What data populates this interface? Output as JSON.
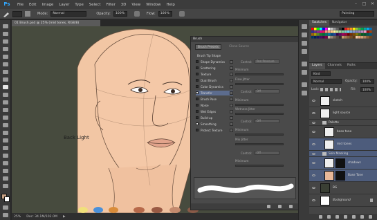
{
  "app": {
    "logo": "Ps",
    "menu": [
      "File",
      "Edit",
      "Image",
      "Layer",
      "Type",
      "Select",
      "Filter",
      "3D",
      "View",
      "Window",
      "Help"
    ],
    "workspace": "Painting"
  },
  "options": {
    "mode_label": "Mode:",
    "mode_value": "Normal",
    "opacity_label": "Opacity:",
    "opacity_value": "100%",
    "flow_label": "Flow:",
    "flow_value": "100%"
  },
  "document": {
    "tab_title": "01 Brush.psd @ 25% (mid tones, RGB/8)",
    "canvas_text": "Back Light",
    "zoom": "25%",
    "doc_info": "Doc: 34.1M/102.0M"
  },
  "brush_panel": {
    "title": "Brush",
    "tab_presets": "Brush Presets",
    "tab_clone": "Clone Source",
    "section_header": "Brush Tip Shape",
    "items": [
      {
        "label": "Shape Dynamics",
        "checked": false
      },
      {
        "label": "Scattering",
        "checked": false
      },
      {
        "label": "Texture",
        "checked": false
      },
      {
        "label": "Dual Brush",
        "checked": false
      },
      {
        "label": "Color Dynamics",
        "checked": false
      },
      {
        "label": "Transfer",
        "checked": true
      },
      {
        "label": "Brush Pose",
        "checked": false
      },
      {
        "label": "Noise",
        "checked": false
      },
      {
        "label": "Wet Edges",
        "checked": false
      },
      {
        "label": "Build-up",
        "checked": false
      },
      {
        "label": "Smoothing",
        "checked": true
      },
      {
        "label": "Protect Texture",
        "checked": false
      }
    ],
    "control_label": "Control:",
    "control_value_1": "Pen Pressure",
    "control_value_off": "Off",
    "minimum_label": "Minimum",
    "flow_jitter_label": "Flow Jitter",
    "wetness_jitter_label": "Wetness Jitter",
    "mix_jitter_label": "Mix Jitter"
  },
  "swatches_panel": {
    "tabs": [
      "Swatches",
      "Navigator"
    ],
    "colors": [
      "#ff0000",
      "#ffff00",
      "#00ff00",
      "#00ffff",
      "#0000ff",
      "#ff00ff",
      "#ffffff",
      "#c8c8c8",
      "#969696",
      "#646464",
      "#323232",
      "#000000",
      "#ed1c24",
      "#f26522",
      "#f7941d",
      "#fff200",
      "#8dc63f",
      "#39b54a",
      "#00a651",
      "#00a99d",
      "#00aeef",
      "#0072bc",
      "#2e3192",
      "#662d91",
      "#92278f",
      "#ec008c",
      "#ed145b",
      "#f69679",
      "#f9ad81",
      "#fdc68a",
      "#fff799",
      "#c4df9b",
      "#a3d39c",
      "#82ca9c",
      "#7accc8",
      "#6dcff6",
      "#7da7d9",
      "#8393ca",
      "#8781bd",
      "#a186be",
      "#bd8cbf",
      "#f49ac1",
      "#9e0b0f",
      "#a0410d",
      "#a36209",
      "#aba000",
      "#598527",
      "#1a7b30",
      "#007236",
      "#00746b",
      "#0076a3",
      "#004b80",
      "#21409a",
      "#32004b",
      "#630460",
      "#9e005d",
      "#9e0039",
      "#790000",
      "#7b2e00",
      "#7d4900",
      "#827b00",
      "#406618",
      "#005e20",
      "#005826",
      "#005952",
      "#005b7f",
      "#003663",
      "#002157",
      "#1b1464",
      "#440e62",
      "#4b0049",
      "#7b0046",
      "#c7b299",
      "#998675",
      "#736357",
      "#534741",
      "#37302a",
      "#c69c6d",
      "#a67c52",
      "#8c6239",
      "#754c24",
      "#603913",
      "#f5cba7",
      "#e8a87c",
      "#d4a373",
      "#b5835a",
      "#8b5e34",
      "#6f4518"
    ]
  },
  "layers_panel": {
    "tabs": [
      "Layers",
      "Channels",
      "Paths"
    ],
    "kind_label": "Kind",
    "blend_mode": "Normal",
    "opacity_label": "Opacity:",
    "opacity_value": "100%",
    "lock_label": "Lock:",
    "fill_label": "Fill:",
    "fill_value": "100%",
    "layers": [
      {
        "name": "sketch",
        "type": "layer",
        "indent": 0,
        "selected": false,
        "thumb": "#f0f0f0"
      },
      {
        "name": "light source",
        "type": "layer",
        "indent": 0,
        "selected": false,
        "thumb": "#f0f0f0"
      },
      {
        "name": "Palette",
        "type": "group",
        "indent": 0,
        "selected": false
      },
      {
        "name": "base tone",
        "type": "layer",
        "indent": 1,
        "selected": false,
        "thumb": "#f0f0f0"
      },
      {
        "name": "mid tones",
        "type": "layer",
        "indent": 1,
        "selected": true,
        "thumb": "#f0f0f0"
      },
      {
        "name": "Skin Masking",
        "type": "group",
        "indent": 0,
        "selected": true
      },
      {
        "name": "shadows",
        "type": "layer",
        "indent": 1,
        "selected": true,
        "thumb": "#f0f0f0",
        "mask": true
      },
      {
        "name": "Base Tone",
        "type": "layer",
        "indent": 1,
        "selected": true,
        "thumb": "#e8b899",
        "mask": true
      },
      {
        "name": "BG",
        "type": "layer",
        "indent": 0,
        "selected": false,
        "thumb": "#3a3f34"
      },
      {
        "name": "Background",
        "type": "layer",
        "indent": 0,
        "selected": false,
        "thumb": "#ffffff"
      }
    ]
  },
  "palette_blobs": [
    "#f0e07a",
    "#4a90d9",
    "#d98c3a",
    "#b7694a",
    "#9a5a44",
    "#c48a6e",
    "#8a5a48"
  ]
}
